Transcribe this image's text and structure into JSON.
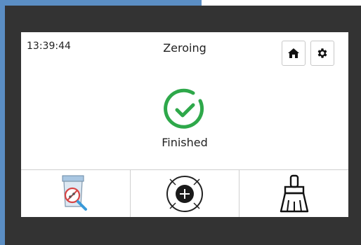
{
  "header": {
    "time": "13:39:44",
    "title": "Zeroing"
  },
  "status": {
    "text": "Finished",
    "icon": "check-circle-icon",
    "color": "#2ea84a"
  },
  "toolbar": {
    "home_icon": "home-icon",
    "settings_icon": "gear-icon"
  },
  "bottom_bar": {
    "buttons": [
      {
        "icon": "sample-inspection-icon"
      },
      {
        "icon": "add-crosshair-icon"
      },
      {
        "icon": "broom-clean-icon"
      }
    ]
  }
}
